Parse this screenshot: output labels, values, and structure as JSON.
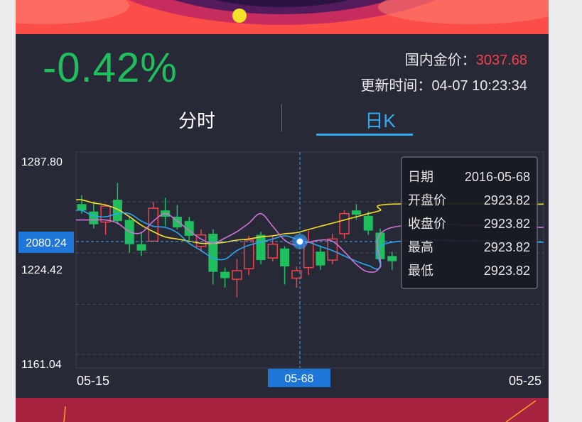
{
  "change_percent": "-0.42%",
  "domestic_price": {
    "label": "国内金价：",
    "value": "3037.68"
  },
  "update_time": {
    "label": "更新时间：",
    "value": "04-07 10:23:34"
  },
  "tabs": [
    {
      "label": "分时",
      "active": false
    },
    {
      "label": "日K",
      "active": true
    }
  ],
  "colors": {
    "up": "#f1424c",
    "down": "#1fbf5e",
    "accent": "#33a9f5",
    "ma1": "#f5e02a",
    "ma2": "#2aa6f0",
    "ma3": "#d072d6"
  },
  "crosshair": {
    "price_label": "2080.24",
    "date_label": "05-68"
  },
  "tooltip": {
    "rows": [
      {
        "label": "日期",
        "value": "2016-05-68"
      },
      {
        "label": "开盘价",
        "value": "2923.82"
      },
      {
        "label": "收盘价",
        "value": "2923.82"
      },
      {
        "label": "最高",
        "value": "2923.82"
      },
      {
        "label": "最低",
        "value": "2923.82"
      }
    ]
  },
  "chart_data": {
    "type": "candlestick",
    "y_tick_labels": [
      "1287.80",
      "1224.42",
      "1161.04"
    ],
    "x_tick_labels": [
      "05-15",
      "05-25"
    ],
    "ylim": [
      1161.04,
      1287.8
    ],
    "candles": [
      {
        "o": 1260.8,
        "c": 1256.8,
        "h": 1266.4,
        "l": 1254.8
      },
      {
        "o": 1256.1,
        "c": 1248.1,
        "h": 1262.4,
        "l": 1245.4
      },
      {
        "o": 1249.5,
        "c": 1259.5,
        "h": 1260.8,
        "l": 1241.4
      },
      {
        "o": 1263.5,
        "c": 1250.1,
        "h": 1274.2,
        "l": 1248.1
      },
      {
        "o": 1250.8,
        "c": 1235.5,
        "h": 1252.8,
        "l": 1230.1
      },
      {
        "o": 1235.5,
        "c": 1231.5,
        "h": 1242.8,
        "l": 1228.1
      },
      {
        "o": 1237.4,
        "c": 1258.2,
        "h": 1262.2,
        "l": 1237.4
      },
      {
        "o": 1256.8,
        "c": 1252.8,
        "h": 1264.8,
        "l": 1246.8
      },
      {
        "o": 1252.8,
        "c": 1246.1,
        "h": 1260.2,
        "l": 1244.8
      },
      {
        "o": 1250.1,
        "c": 1240.8,
        "h": 1252.8,
        "l": 1238.1
      },
      {
        "o": 1234.1,
        "c": 1241.4,
        "h": 1244.8,
        "l": 1230.8
      },
      {
        "o": 1242.1,
        "c": 1218.1,
        "h": 1244.8,
        "l": 1210.1
      },
      {
        "o": 1218.1,
        "c": 1214.1,
        "h": 1220.8,
        "l": 1208.1
      },
      {
        "o": 1213.4,
        "c": 1218.8,
        "h": 1226.1,
        "l": 1202.1
      },
      {
        "o": 1220.1,
        "c": 1238.1,
        "h": 1240.8,
        "l": 1216.1
      },
      {
        "o": 1241.4,
        "c": 1225.5,
        "h": 1243.4,
        "l": 1222.8
      },
      {
        "o": 1226.8,
        "c": 1235.5,
        "h": 1240.8,
        "l": 1224.8
      },
      {
        "o": 1232.8,
        "c": 1221.5,
        "h": 1234.1,
        "l": 1210.1
      },
      {
        "o": 1214.1,
        "c": 1218.8,
        "h": 1221.5,
        "l": 1208.1
      },
      {
        "o": 1220.8,
        "c": 1236.8,
        "h": 1244.1,
        "l": 1216.1
      },
      {
        "o": 1230.8,
        "c": 1222.1,
        "h": 1234.8,
        "l": 1219.4
      },
      {
        "o": 1225.5,
        "c": 1238.8,
        "h": 1242.1,
        "l": 1222.8
      },
      {
        "o": 1242.1,
        "c": 1254.8,
        "h": 1256.8,
        "l": 1238.8
      },
      {
        "o": 1256.8,
        "c": 1254.1,
        "h": 1260.8,
        "l": 1250.8
      },
      {
        "o": 1253.4,
        "c": 1244.1,
        "h": 1256.1,
        "l": 1241.4
      },
      {
        "o": 1242.8,
        "c": 1226.1,
        "h": 1245.4,
        "l": 1222.1
      },
      {
        "o": 1228.1,
        "c": 1224.8,
        "h": 1230.8,
        "l": 1219.4
      }
    ],
    "moving_averages": [
      {
        "color": "yellow",
        "values": [
          1263.5,
          1261.5,
          1260.2,
          1257.5,
          1252.8,
          1247.5,
          1243.4,
          1240.1,
          1238.8,
          1237.4,
          1236.1,
          1236.1,
          1236.8,
          1238.1,
          1238.8,
          1240.1,
          1240.8,
          1242.1,
          1242.8,
          1244.8,
          1246.8,
          1248.8,
          1250.8,
          1252.8,
          1254.8,
          1256.8,
          1260.8
        ]
      },
      {
        "color": "blue",
        "values": [
          1256.8,
          1253.4,
          1252.8,
          1254.8,
          1254.8,
          1250.1,
          1246.8,
          1246.1,
          1242.8,
          1236.1,
          1231.5,
          1226.8,
          1226.1,
          1231.5,
          1234.8,
          1236.8,
          1238.8,
          1240.8,
          1238.8,
          1236.8,
          1234.1,
          1231.5,
          1228.1,
          1224.8,
          1222.1,
          1220.8,
          1236.8
        ]
      },
      {
        "color": "violet",
        "values": [
          1250.8,
          1250.8,
          1250.8,
          1248.8,
          1243.4,
          1242.8,
          1250.1,
          1254.8,
          1250.1,
          1244.1,
          1238.8,
          1236.1,
          1239.4,
          1243.4,
          1248.8,
          1254.8,
          1246.8,
          1238.1,
          1234.8,
          1236.8,
          1238.1,
          1237.4,
          1230.8,
          1222.8,
          1218.1,
          1221.5,
          1246.1
        ]
      }
    ]
  }
}
